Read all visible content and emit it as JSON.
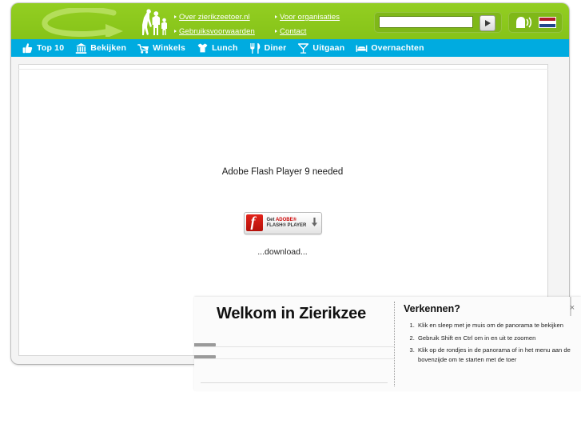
{
  "site": {
    "logo_alt": "zierikzeetoer logo"
  },
  "header": {
    "links": [
      {
        "label": "Over zierikzeetoer.nl"
      },
      {
        "label": "Gebruiksvoorwaarden"
      },
      {
        "label": "Voor organisaties"
      },
      {
        "label": "Contact"
      }
    ],
    "search": {
      "value": "",
      "placeholder": "",
      "submit_icon": "play-arrow-icon"
    },
    "tools": {
      "speak_icon": "speaker-head-icon",
      "flag_icon": "dutch-flag-icon",
      "flag_label": "NL"
    },
    "colors": {
      "green": "#8cc81e",
      "blue": "#00abe0"
    }
  },
  "nav": {
    "items": [
      {
        "label": "Top 10",
        "icon": "thumbs-up-icon"
      },
      {
        "label": "Bekijken",
        "icon": "museum-icon"
      },
      {
        "label": "Winkels",
        "icon": "shopping-cart-icon"
      },
      {
        "label": "Lunch",
        "icon": "sandwich-icon"
      },
      {
        "label": "Diner",
        "icon": "fork-knife-icon"
      },
      {
        "label": "Uitgaan",
        "icon": "cocktail-glass-icon"
      },
      {
        "label": "Overnachten",
        "icon": "bed-icon"
      }
    ]
  },
  "main": {
    "flash": {
      "message": "Adobe Flash Player 9 needed",
      "badge": {
        "line1_prefix": "Get ",
        "line1_brand": "ADOBE®",
        "line2": "FLASH® PLAYER",
        "download_icon": "download-arrow-icon"
      },
      "download_text": "...download..."
    }
  },
  "overlay": {
    "title": "Welkom in Zierikzee",
    "subtitle": "Verkennen?",
    "steps": [
      "Klik en sleep met je muis om de panorama te bekijken",
      "Gebruik Shift en Ctrl om in en uit te zoomen",
      "Klik op de rondjes in de panorama of in het menu aan de bovenzijde om te starten met de toer"
    ],
    "close_label": "×"
  }
}
